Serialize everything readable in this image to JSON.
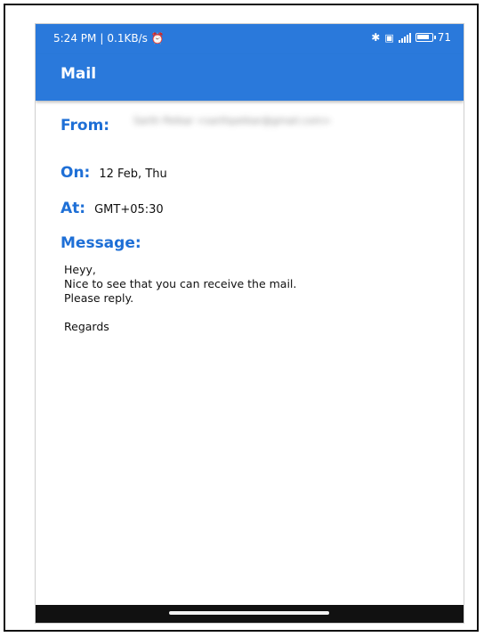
{
  "status_bar": {
    "time": "5:24 PM",
    "network_speed": "0.1KB/s",
    "battery_level": "71",
    "icons": [
      "alarm-icon",
      "bluetooth-icon",
      "vibrate-icon",
      "signal-icon",
      "battery-icon"
    ]
  },
  "app_bar": {
    "title": "Mail"
  },
  "mail": {
    "from_label": "From:",
    "from_value": "Sarth Petkar <sarthpetkar@gmail.com>",
    "on_label": "On:",
    "on_value": "12 Feb, Thu",
    "at_label": "At:",
    "at_value": "GMT+05:30",
    "message_label": "Message:",
    "message_lines": [
      "Heyy,",
      "Nice to see that you can receive the mail.",
      "Please reply."
    ],
    "message_closing": "Regards"
  },
  "colors": {
    "accent": "#2a79db",
    "label_blue": "#1e6fd6",
    "text": "#111111"
  }
}
